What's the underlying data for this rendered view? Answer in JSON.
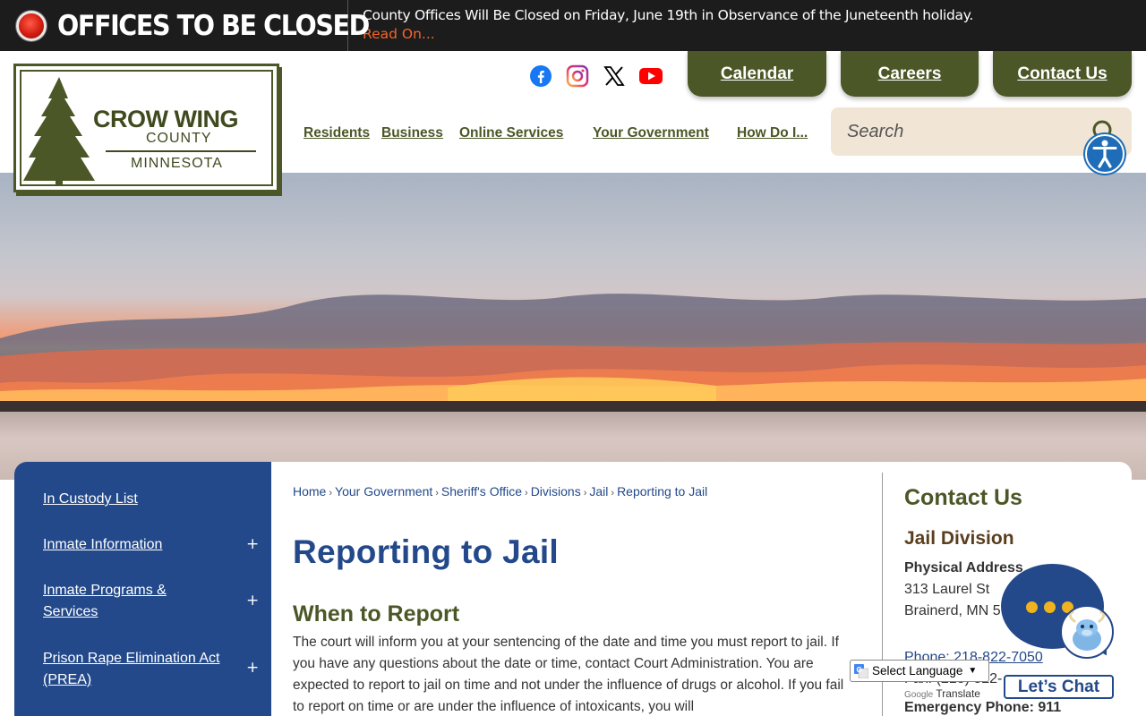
{
  "alert": {
    "title": "OFFICES TO BE CLOSED",
    "message": "County Offices Will Be Closed on Friday, June 19th in Observance of the Juneteenth holiday.",
    "link": "Read On..."
  },
  "logo": {
    "line1": "CROW WING",
    "line2": "COUNTY",
    "line3": "MINNESOTA"
  },
  "social": [
    "facebook-icon",
    "instagram-icon",
    "x-icon",
    "youtube-icon"
  ],
  "top_buttons": {
    "calendar": "Calendar",
    "careers": "Careers",
    "contact": "Contact Us"
  },
  "nav": {
    "residents": "Residents",
    "business": "Business",
    "online_services": "Online Services",
    "your_government": "Your Government",
    "how_do_i": "How Do I..."
  },
  "search": {
    "placeholder": "Search"
  },
  "sidebar": {
    "items": [
      {
        "label": "In Custody List"
      },
      {
        "label": "Inmate Information"
      },
      {
        "label": "Inmate Programs & Services"
      },
      {
        "label": "Prison Rape Elimination Act (PREA)"
      }
    ],
    "expand_symbol": "+"
  },
  "breadcrumb": [
    "Home",
    "Your Government",
    "Sheriff's Office",
    "Divisions",
    "Jail",
    "Reporting to Jail"
  ],
  "breadcrumb_sep": "›",
  "page": {
    "title": "Reporting to Jail",
    "section_title": "When to Report",
    "body": "The court will inform you at your sentencing of the date and time you must report to jail. If you have any questions about the date or time, contact Court Administration. You are expected to report to jail on time and not under the influence of drugs or alcohol. If you fail to report on time or are under the influence of intoxicants, you will"
  },
  "contact": {
    "title": "Contact Us",
    "division": "Jail Division",
    "address_label": "Physical Address",
    "address_line1": "313 Laurel St",
    "address_line2": "Brainerd, MN 5",
    "phone": "Phone: 218-822-7050",
    "fax": "Fax: (218) 822-",
    "emergency": "Emergency Phone: 911"
  },
  "chat": {
    "label": "Let’s Chat"
  },
  "translate": {
    "select": "Select Language",
    "powered_by": "Google",
    "translate": "Translate"
  },
  "colors": {
    "olive": "#4b5726",
    "navy": "#23498a",
    "alert_bg": "#1c1c1c",
    "alert_link": "#f2652b",
    "search_bg": "#f1e6d6"
  }
}
